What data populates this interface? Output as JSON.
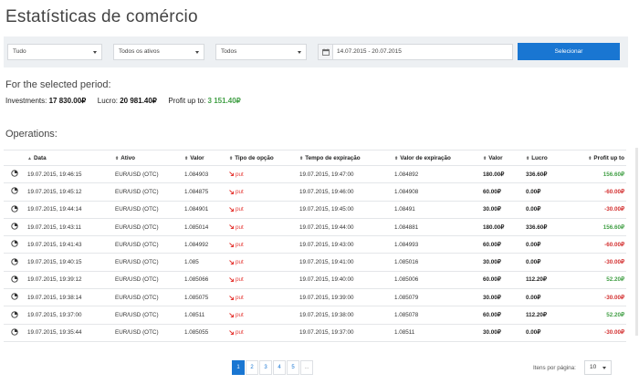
{
  "page": {
    "title": "Estatísticas de comércio"
  },
  "filters": {
    "type": "Tudo",
    "assets": "Todos os ativos",
    "options": "Todos",
    "date_range": "14.07.2015 - 20.07.2015",
    "select_label": "Selecionar"
  },
  "period": {
    "title": "For the selected period:",
    "investments_label": "Investments:",
    "investments_value": "17 830.00₽",
    "profit_label": "Lucro:",
    "profit_value": "20 981.40₽",
    "profit_up_label": "Profit up to:",
    "profit_up_value": "3 151.40₽"
  },
  "operations": {
    "title": "Operations:",
    "headers": {
      "date": "Data",
      "asset": "Ativo",
      "value": "Valor",
      "option_type": "Tipo de opção",
      "expiry_time": "Tempo de expiração",
      "expiry_value": "Valor de expiração",
      "amount": "Valor",
      "profit": "Lucro",
      "profit_up": "Profit up to"
    },
    "rows": [
      {
        "date": "19.07.2015, 19:46:15",
        "asset": "EUR/USD (OTC)",
        "value": "1.084903",
        "type": "put",
        "expiry_time": "19.07.2015, 19:47:00",
        "expiry_value": "1.084892",
        "amount": "180.00₽",
        "profit": "336.60₽",
        "profit_up": "156.60₽",
        "status": "pos"
      },
      {
        "date": "19.07.2015, 19:45:12",
        "asset": "EUR/USD (OTC)",
        "value": "1.084875",
        "type": "put",
        "expiry_time": "19.07.2015, 19:46:00",
        "expiry_value": "1.084908",
        "amount": "60.00₽",
        "profit": "0.00₽",
        "profit_up": "-60.00₽",
        "status": "neg"
      },
      {
        "date": "19.07.2015, 19:44:14",
        "asset": "EUR/USD (OTC)",
        "value": "1.084901",
        "type": "put",
        "expiry_time": "19.07.2015, 19:45:00",
        "expiry_value": "1.08491",
        "amount": "30.00₽",
        "profit": "0.00₽",
        "profit_up": "-30.00₽",
        "status": "neg"
      },
      {
        "date": "19.07.2015, 19:43:11",
        "asset": "EUR/USD (OTC)",
        "value": "1.085014",
        "type": "put",
        "expiry_time": "19.07.2015, 19:44:00",
        "expiry_value": "1.084881",
        "amount": "180.00₽",
        "profit": "336.60₽",
        "profit_up": "156.60₽",
        "status": "pos"
      },
      {
        "date": "19.07.2015, 19:41:43",
        "asset": "EUR/USD (OTC)",
        "value": "1.084992",
        "type": "put",
        "expiry_time": "19.07.2015, 19:43:00",
        "expiry_value": "1.084993",
        "amount": "60.00₽",
        "profit": "0.00₽",
        "profit_up": "-60.00₽",
        "status": "neg"
      },
      {
        "date": "19.07.2015, 19:40:15",
        "asset": "EUR/USD (OTC)",
        "value": "1.085",
        "type": "put",
        "expiry_time": "19.07.2015, 19:41:00",
        "expiry_value": "1.085016",
        "amount": "30.00₽",
        "profit": "0.00₽",
        "profit_up": "-30.00₽",
        "status": "neg"
      },
      {
        "date": "19.07.2015, 19:39:12",
        "asset": "EUR/USD (OTC)",
        "value": "1.085066",
        "type": "put",
        "expiry_time": "19.07.2015, 19:40:00",
        "expiry_value": "1.085006",
        "amount": "60.00₽",
        "profit": "112.20₽",
        "profit_up": "52.20₽",
        "status": "pos"
      },
      {
        "date": "19.07.2015, 19:38:14",
        "asset": "EUR/USD (OTC)",
        "value": "1.085075",
        "type": "put",
        "expiry_time": "19.07.2015, 19:39:00",
        "expiry_value": "1.085079",
        "amount": "30.00₽",
        "profit": "0.00₽",
        "profit_up": "-30.00₽",
        "status": "neg"
      },
      {
        "date": "19.07.2015, 19:37:00",
        "asset": "EUR/USD (OTC)",
        "value": "1.08511",
        "type": "put",
        "expiry_time": "19.07.2015, 19:38:00",
        "expiry_value": "1.085078",
        "amount": "60.00₽",
        "profit": "112.20₽",
        "profit_up": "52.20₽",
        "status": "pos"
      },
      {
        "date": "19.07.2015, 19:35:44",
        "asset": "EUR/USD (OTC)",
        "value": "1.085055",
        "type": "put",
        "expiry_time": "19.07.2015, 19:37:00",
        "expiry_value": "1.08511",
        "amount": "30.00₽",
        "profit": "0.00₽",
        "profit_up": "-30.00₽",
        "status": "neg"
      }
    ]
  },
  "pagination": {
    "pages": [
      "1",
      "2",
      "3",
      "4",
      "5",
      "..."
    ],
    "active": 0
  },
  "per_page": {
    "label": "Itens por página:",
    "value": "10"
  },
  "colors": {
    "accent": "#1976d2",
    "positive": "#43a047",
    "negative": "#d32f2f"
  },
  "icons": {
    "row": "clock-icon",
    "put": "arrow-down-right-icon",
    "calendar": "calendar-icon"
  }
}
